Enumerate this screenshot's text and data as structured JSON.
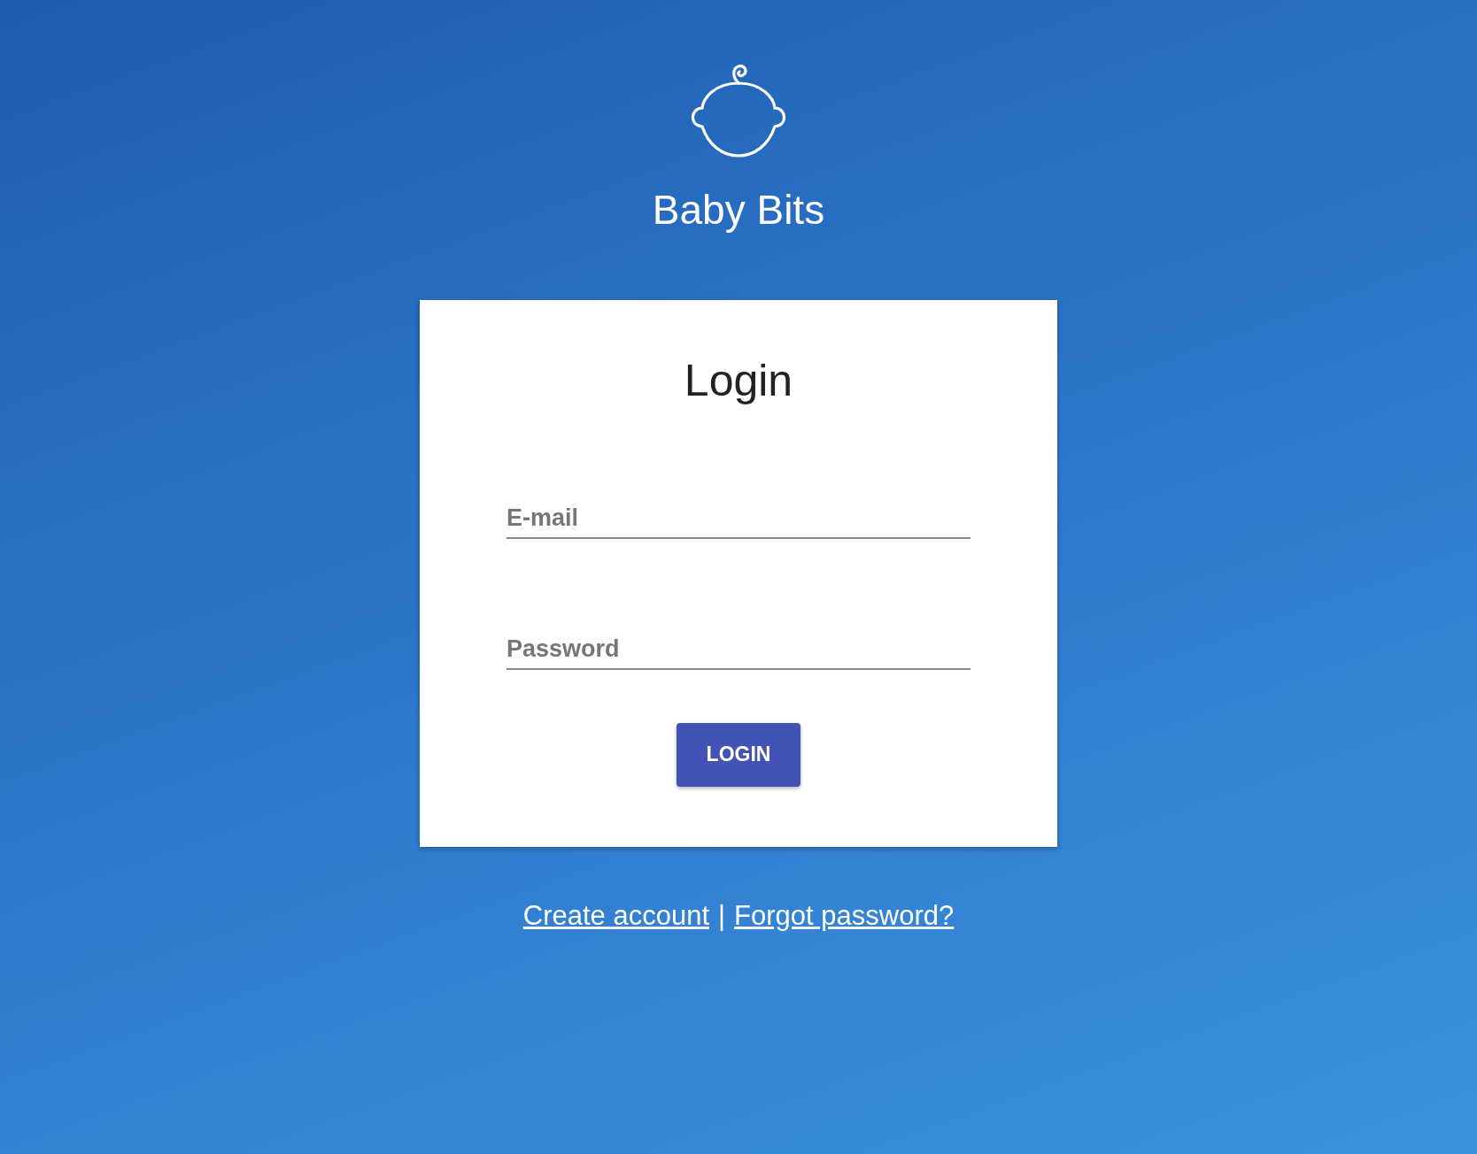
{
  "app": {
    "name": "Baby Bits"
  },
  "login_card": {
    "title": "Login",
    "fields": [
      {
        "placeholder": "E-mail"
      },
      {
        "placeholder": "Password"
      }
    ],
    "button": "LOGIN"
  },
  "links": [
    {
      "label": "Create account"
    },
    {
      "label": "|",
      "kind": "separator"
    },
    {
      "label": "Forgot password?"
    }
  ]
}
